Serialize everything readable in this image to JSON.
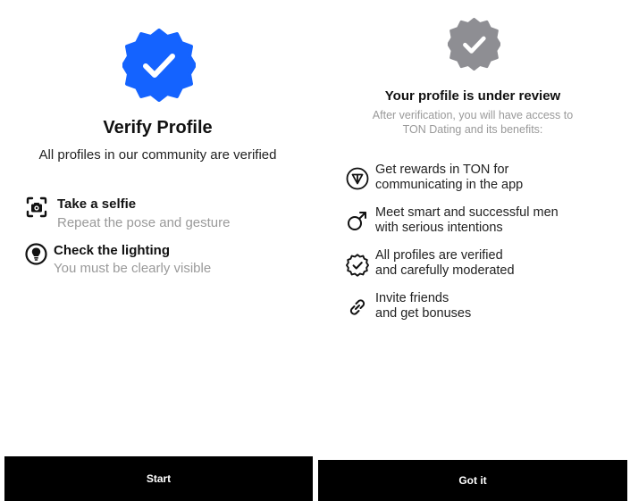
{
  "verify": {
    "title": "Verify Profile",
    "subtitle": "All profiles in our community are verified",
    "steps": [
      {
        "title": "Take a selfie",
        "description": "Repeat the pose and gesture",
        "icon": "camera-scan-icon"
      },
      {
        "title": "Check the lighting",
        "description": "You must be clearly visible",
        "icon": "lightbulb-icon"
      }
    ],
    "start_label": "Start",
    "badge_icon": "verified-badge-icon",
    "accent_color": "#1463FF"
  },
  "review": {
    "title": "Your profile is under review",
    "subtitle_line1": "After verification, you will have access to",
    "subtitle_line2": "TON Dating and its benefits:",
    "benefits": [
      {
        "line1": "Get rewards in TON for",
        "line2": "communicating in the app",
        "icon": "ton-icon"
      },
      {
        "line1": "Meet smart and successful men",
        "line2": "with serious intentions",
        "icon": "male-symbol-icon"
      },
      {
        "line1": "All profiles are verified",
        "line2": "and carefully moderated",
        "icon": "verified-check-icon"
      },
      {
        "line1": "Invite friends",
        "line2": "and get bonuses",
        "icon": "link-icon"
      }
    ],
    "got_it_label": "Got it",
    "badge_icon": "pending-badge-icon",
    "badge_color": "#8E8E93"
  }
}
